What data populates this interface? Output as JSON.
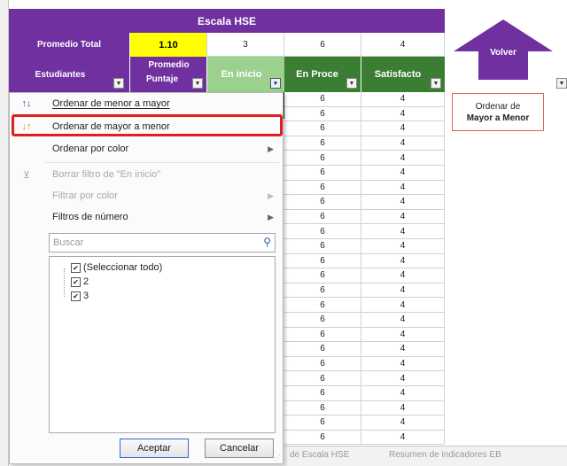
{
  "sheet": {
    "title": "Escala HSE",
    "summary": {
      "label": "Promedio Total",
      "values": [
        "1.10",
        "3",
        "6",
        "4"
      ]
    },
    "headers": {
      "students": "Estudiantes",
      "score": "Promedio Puntaje",
      "score_line1": "Promedio",
      "score_line2": "Puntaje",
      "in_start": "En inicio",
      "in_process": "En Proce",
      "satisfactory": "Satisfacto"
    },
    "col_proceso_values": [
      "6",
      "6",
      "6",
      "6",
      "6",
      "6",
      "6",
      "6",
      "6",
      "6",
      "6",
      "6",
      "6",
      "6",
      "6",
      "6",
      "6",
      "6",
      "6",
      "6",
      "6",
      "6",
      "6",
      "6"
    ],
    "col_satisf_values": [
      "4",
      "4",
      "4",
      "4",
      "4",
      "4",
      "4",
      "4",
      "4",
      "4",
      "4",
      "4",
      "4",
      "4",
      "4",
      "4",
      "4",
      "4",
      "4",
      "4",
      "4",
      "4",
      "4",
      "4"
    ],
    "tabs": [
      "de Escala HSE",
      "Resumen de indicadores EB"
    ]
  },
  "side": {
    "back_button": "Volver",
    "sort_button_line1": "Ordenar de",
    "sort_button_line2": "Mayor a Menor"
  },
  "filter_menu": {
    "items": [
      {
        "label": "Ordenar de menor a mayor",
        "icon": "sort-asc-icon"
      },
      {
        "label": "Ordenar de mayor a menor",
        "icon": "sort-desc-icon",
        "highlighted": true
      },
      {
        "label": "Ordenar por color",
        "submenu": true
      },
      {
        "label": "Borrar filtro de \"En inicio\"",
        "disabled": true,
        "icon": "clear-filter-icon"
      },
      {
        "label": "Filtrar por color",
        "disabled": true,
        "submenu": true
      },
      {
        "label": "Filtros de número",
        "submenu": true
      }
    ],
    "search_placeholder": "Buscar",
    "tree": [
      "(Seleccionar todo)",
      "2",
      "3"
    ],
    "accept": "Aceptar",
    "cancel": "Cancelar"
  },
  "colors": {
    "purple": "#7030a0",
    "yellow": "#ffff00",
    "green_dark": "#3a7d33",
    "green_light": "#9bd08f",
    "highlight": "#e02020"
  }
}
